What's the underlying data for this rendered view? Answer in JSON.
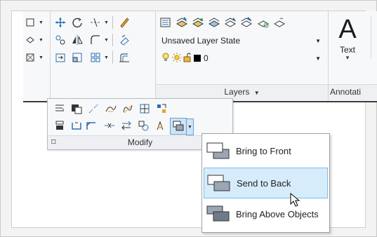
{
  "layers": {
    "state_value": "Unsaved Layer State",
    "layer_value": "0",
    "panel_label": "Layers",
    "panel_arrow": "▼"
  },
  "annotation": {
    "big_button_glyph": "A",
    "text_label": "Text",
    "text_arrow": "▾",
    "panel_label": "Annotati"
  },
  "modify": {
    "panel_label": "Modify",
    "pin_glyph": "⌑"
  },
  "draw_order_menu": {
    "items": [
      {
        "label": "Bring to Front",
        "selected": false
      },
      {
        "label": "Send to Back",
        "selected": true
      },
      {
        "label": "Bring Above Objects",
        "selected": false
      }
    ]
  },
  "colors": {
    "selected_bg": "#d6ecfb",
    "selected_border": "#7cbde9",
    "panel_bar": "#eef0f3"
  }
}
